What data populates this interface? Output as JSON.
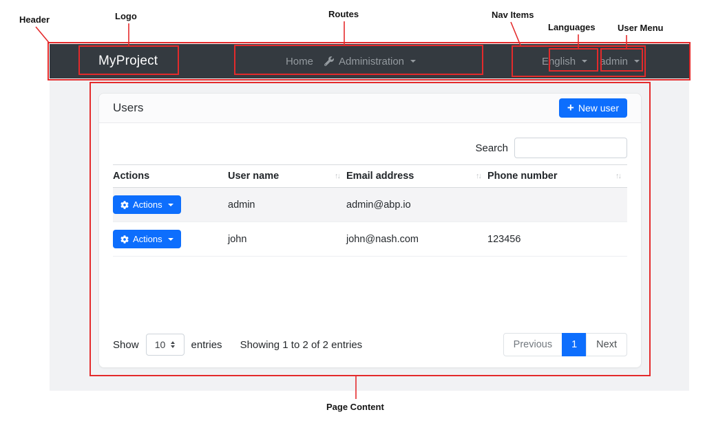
{
  "colors": {
    "primary": "#0d6efd",
    "navbar_bg": "#343a40",
    "page_bg": "#f1f2f4",
    "annotation_red": "#e42a2b"
  },
  "icons": {
    "plus": "+",
    "sort": "↑↓",
    "wrench": "wrench-icon",
    "gear": "gear-icon",
    "caret": "caret-down-icon"
  },
  "annotations": {
    "header": "Header",
    "logo": "Logo",
    "routes": "Routes",
    "nav_items": "Nav Items",
    "languages": "Languages",
    "user_menu": "User Menu",
    "page_content": "Page Content"
  },
  "navbar": {
    "brand": "MyProject",
    "home": "Home",
    "administration": "Administration",
    "language": "English",
    "user": "admin"
  },
  "content": {
    "title": "Users",
    "new_user_label": "New user",
    "search_label": "Search",
    "search_value": "",
    "table": {
      "columns": [
        "Actions",
        "User name",
        "Email address",
        "Phone number"
      ],
      "rows": [
        {
          "action_label": "Actions",
          "user_name": "admin",
          "email": "admin@abp.io",
          "phone": ""
        },
        {
          "action_label": "Actions",
          "user_name": "john",
          "email": "john@nash.com",
          "phone": "123456"
        }
      ]
    },
    "footer": {
      "show": "Show",
      "page_size": "10",
      "entries": "entries",
      "info": "Showing 1 to 2 of 2 entries",
      "previous": "Previous",
      "page": "1",
      "next": "Next"
    }
  }
}
